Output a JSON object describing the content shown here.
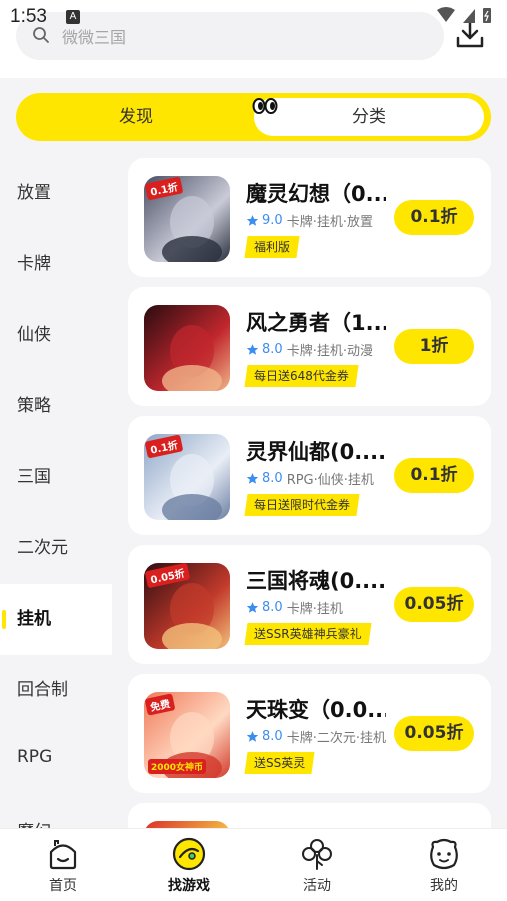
{
  "status": {
    "time": "1:53",
    "a_badge": "A"
  },
  "search": {
    "placeholder": "微微三国"
  },
  "tabs": {
    "discover": "发现",
    "category": "分类"
  },
  "sidebar": {
    "items": [
      {
        "label": "放置",
        "active": false
      },
      {
        "label": "卡牌",
        "active": false
      },
      {
        "label": "仙侠",
        "active": false
      },
      {
        "label": "策略",
        "active": false
      },
      {
        "label": "三国",
        "active": false
      },
      {
        "label": "二次元",
        "active": false
      },
      {
        "label": "挂机",
        "active": true
      },
      {
        "label": "回合制",
        "active": false
      },
      {
        "label": "RPG",
        "active": false
      },
      {
        "label": "魔幻",
        "active": false
      }
    ]
  },
  "games": [
    {
      "name": "魔灵幻想（0...",
      "score": "9.0",
      "tags": "卡牌·挂机·放置",
      "badge": "福利版",
      "discount": "0.1折",
      "thumb_label": "0.1折",
      "palette": [
        "#4a4f63",
        "#c9cbd8",
        "#2b2f3d"
      ]
    },
    {
      "name": "风之勇者（1...",
      "score": "8.0",
      "tags": "卡牌·挂机·动漫",
      "badge": "每日送648代金券",
      "discount": "1折",
      "thumb_label": "",
      "palette": [
        "#2a0c10",
        "#c0272d",
        "#f0b48a"
      ]
    },
    {
      "name": "灵界仙都(0....",
      "score": "8.0",
      "tags": "RPG·仙侠·挂机",
      "badge": "每日送限时代金券",
      "discount": "0.1折",
      "thumb_label": "0.1折",
      "palette": [
        "#8fa6c7",
        "#e9eef6",
        "#6b7fa3"
      ]
    },
    {
      "name": "三国将魂(0....",
      "score": "8.0",
      "tags": "卡牌·挂机",
      "badge": "送SSR英雄神兵豪礼",
      "discount": "0.05折",
      "thumb_label": "0.05折",
      "palette": [
        "#2e0d12",
        "#c23a2b",
        "#f3c07a"
      ]
    },
    {
      "name": "天珠变（0.0...",
      "score": "8.0",
      "tags": "卡牌·二次元·挂机",
      "badge": "送SS英灵",
      "discount": "0.05折",
      "thumb_label": "免费",
      "thumb_sub": "2000女神币",
      "palette": [
        "#f07a5a",
        "#ffd9c2",
        "#d23a2c"
      ]
    },
    {
      "name": "",
      "score": "",
      "tags": "",
      "badge": "",
      "discount": "",
      "thumb_label": "",
      "palette": [
        "#d9302b",
        "#f6c945",
        "#7a1f1c"
      ]
    }
  ],
  "bottom_nav": [
    {
      "label": "首页",
      "icon": "home-icon",
      "active": false
    },
    {
      "label": "找游戏",
      "icon": "game-controller-icon",
      "active": true
    },
    {
      "label": "活动",
      "icon": "clover-icon",
      "active": false
    },
    {
      "label": "我的",
      "icon": "bear-face-icon",
      "active": false
    }
  ],
  "colors": {
    "accent": "#ffe600",
    "score_blue": "#3c8df0",
    "background": "#f4f4f6"
  }
}
